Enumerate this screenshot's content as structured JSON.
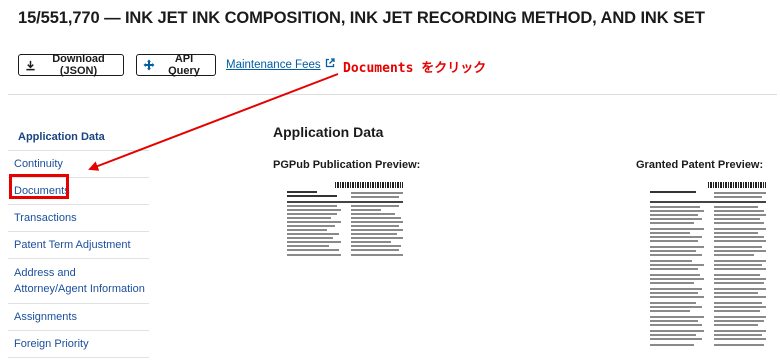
{
  "page": {
    "title": "15/551,770 — INK JET INK COMPOSITION, INK JET RECORDING METHOD, AND INK SET"
  },
  "toolbar": {
    "download_label": "Download (JSON)",
    "api_label": "API Query",
    "maintenance_label": "Maintenance Fees"
  },
  "annotation": {
    "text": "Documents をクリック",
    "color": "#e60000"
  },
  "sidebar": {
    "items": [
      {
        "label": "Application Data"
      },
      {
        "label": "Continuity"
      },
      {
        "label": "Documents"
      },
      {
        "label": "Transactions"
      },
      {
        "label": "Patent Term Adjustment"
      },
      {
        "label": "Address and Attorney/Agent Information"
      },
      {
        "label": "Assignments"
      },
      {
        "label": "Foreign Priority"
      }
    ]
  },
  "main": {
    "heading": "Application Data",
    "pgpub_label": "PGPub Publication Preview:",
    "granted_label": "Granted Patent Preview:"
  },
  "icons": {
    "download": "download-icon",
    "api": "api-move-icon",
    "external": "external-link-icon"
  },
  "colors": {
    "link": "#005ea2",
    "accent": "#e60000"
  }
}
